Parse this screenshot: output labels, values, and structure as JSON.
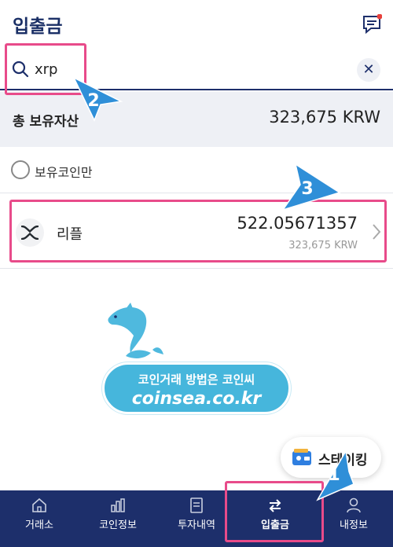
{
  "header": {
    "title": "입출금",
    "chat_icon": "chat-icon"
  },
  "search": {
    "value": "xrp",
    "placeholder": "",
    "clear_icon": "close-icon"
  },
  "summary": {
    "label": "총 보유자산",
    "value": "323,675 KRW"
  },
  "filter": {
    "label": "보유코인만",
    "checked": false
  },
  "coin_row": {
    "name": "리플",
    "amount": "522.05671357",
    "krw_value": "323,675 KRW",
    "logo_icon": "xrp-logo-icon"
  },
  "promo": {
    "line1": "코인거래 방법은 코인씨",
    "line2": "coinsea.co.kr"
  },
  "staking_button": {
    "label": "스테이킹",
    "icon": "wallet-icon"
  },
  "tabs": [
    {
      "label": "거래소",
      "icon": "home-icon",
      "active": false
    },
    {
      "label": "코인정보",
      "icon": "chart-icon",
      "active": false
    },
    {
      "label": "투자내역",
      "icon": "document-icon",
      "active": false
    },
    {
      "label": "입출금",
      "icon": "transfer-icon",
      "active": true
    },
    {
      "label": "내정보",
      "icon": "user-icon",
      "active": false
    }
  ],
  "annotations": {
    "step1": "1",
    "step2": "2",
    "step3": "3"
  },
  "colors": {
    "navy": "#1d2f6b",
    "highlight": "#e84b8a",
    "summary_bg": "#eef0f5",
    "badge_blue": "#2f8fd8"
  }
}
